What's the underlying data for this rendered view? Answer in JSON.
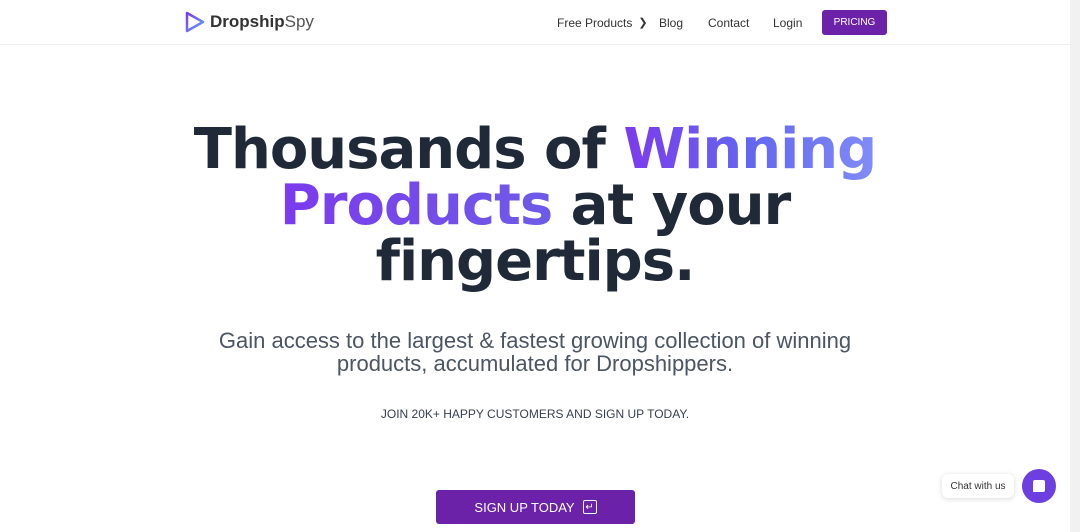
{
  "nav": {
    "brand_bold": "Dropship",
    "brand_light": "Spy",
    "items": [
      "Free Products",
      "Blog",
      "Contact",
      "Login"
    ],
    "pricing": "PRICING"
  },
  "hero": {
    "line1a": "Thousands of ",
    "line1b": "Winning",
    "line2a": "Products",
    "line2b": " at your",
    "line3": "fingertips.",
    "subtitle1": "Gain access to the largest & fastest growing collection of winning",
    "subtitle2": "products, accumulated for Dropshippers.",
    "join": "JOIN 20K+ HAPPY CUSTOMERS AND SIGN UP TODAY.",
    "cta": "SIGN UP TODAY"
  },
  "chat": {
    "label": "Chat with us"
  },
  "colors": {
    "accent": "#6b21a8",
    "chat": "#6d3fe0"
  }
}
